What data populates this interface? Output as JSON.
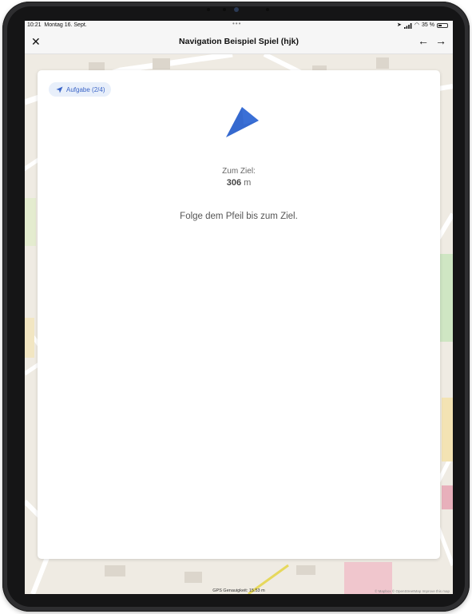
{
  "status_bar": {
    "time": "10:21",
    "date": "Montag 16. Sept.",
    "battery": "35 %"
  },
  "nav": {
    "title": "Navigation Beispiel Spiel (hjk)",
    "close_icon": "close-icon",
    "back_icon": "arrow-left-icon",
    "forward_icon": "arrow-right-icon"
  },
  "card": {
    "task_badge": "Aufgabe (2/4)",
    "target_label": "Zum Ziel:",
    "distance_value": "306",
    "distance_unit": "m",
    "instruction": "Folge dem Pfeil bis zum Ziel.",
    "arrow_color": "#3a6fd6"
  },
  "footer": {
    "gps": "GPS Genauigkeit: 15.53 m",
    "attribution": "© Mapbox © OpenStreetMap Improve this map"
  },
  "colors": {
    "accent": "#3a6fd6",
    "badge_bg": "#e8effa"
  }
}
